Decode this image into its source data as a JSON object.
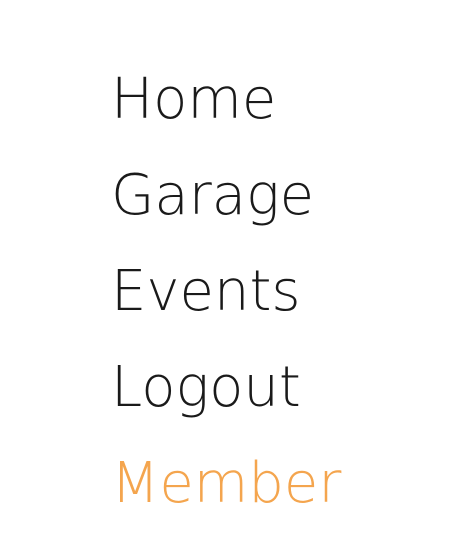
{
  "nav": {
    "items": [
      {
        "label": "Home"
      },
      {
        "label": "Garage"
      },
      {
        "label": "Events"
      },
      {
        "label": "Logout"
      },
      {
        "label": "Member"
      }
    ]
  },
  "colors": {
    "text": "#1a1a1a",
    "accent": "#f4a54e",
    "background": "#ffffff"
  }
}
